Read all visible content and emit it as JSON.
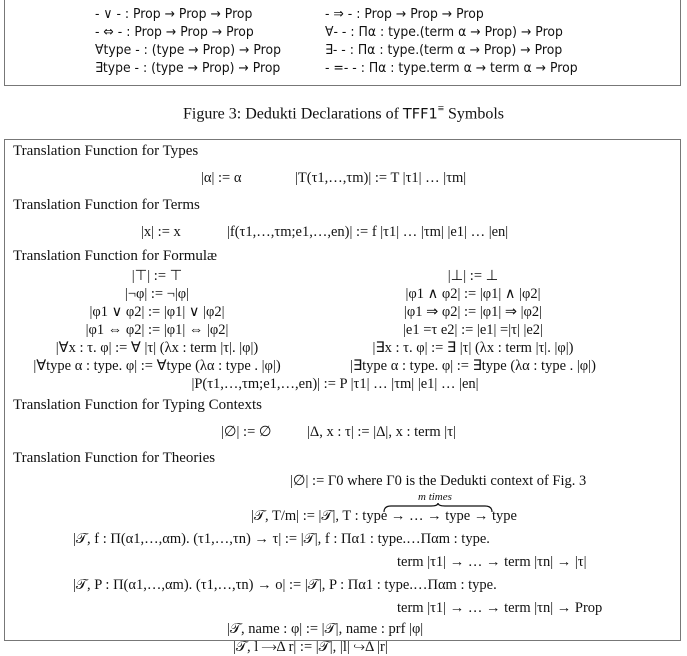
{
  "figure3": {
    "declarations_left": [
      "- ∨ - : Prop → Prop → Prop",
      "- ⇔ - : Prop → Prop → Prop",
      "∀type - : (type → Prop) → Prop",
      "∃type - : (type → Prop) → Prop"
    ],
    "declarations_right": [
      "- ⇒ - : Prop → Prop → Prop",
      "∀- - : Πα : type.(term α → Prop) → Prop",
      "∃- - : Πα : type.(term α → Prop) → Prop",
      "- =- - : Πα : type.term α → term α → Prop"
    ],
    "caption_prefix": "Figure 3: Dedukti Declarations of ",
    "caption_name": "TFF1",
    "caption_sup": "≡",
    "caption_suffix": " Symbols"
  },
  "translation": {
    "types_header": "Translation Function for Types",
    "types": [
      "|α| := α",
      "|T(τ1,…,τm)| := T |τ1| … |τm|"
    ],
    "terms_header": "Translation Function for Terms",
    "terms": [
      "|x| := x",
      "|f(τ1,…,τm;e1,…,en)| := f |τ1| … |τm| |e1| … |en|"
    ],
    "formulae_header": "Translation Function for Formulæ",
    "formulae_left": [
      "|⊤| := ⊤",
      "|¬φ| := ¬|φ|",
      "|φ1 ∨ φ2| := |φ1| ∨ |φ2|",
      "|φ1 ⇔ φ2| := |φ1| ⇔ |φ2|",
      "|∀x : τ. φ| := ∀ |τ| (λx : term |τ|. |φ|)",
      "|∀type α : type. φ| := ∀type (λα : type . |φ|)"
    ],
    "formulae_right": [
      "|⊥| := ⊥",
      "|φ1 ∧ φ2| := |φ1| ∧ |φ2|",
      "|φ1 ⇒ φ2| := |φ1| ⇒ |φ2|",
      "|e1 =τ e2| := |e1| =|τ| |e2|",
      "|∃x : τ. φ| := ∃ |τ| (λx : term |τ|. |φ|)",
      "|∃type α : type. φ| := ∃type (λα : type . |φ|)"
    ],
    "formulae_predicate": "|P(τ1,…,τm;e1,…,en)| := P |τ1| … |τm| |e1| … |en|",
    "contexts_header": "Translation Function for Typing Contexts",
    "contexts": [
      "|∅| := ∅",
      "|Δ, x : τ| := |Δ|, x : term |τ|"
    ],
    "theories_header": "Translation Function for Theories",
    "theories": {
      "empty": "|∅| := Γ0 where Γ0 is the Dedukti context of Fig. 3",
      "brace_label": "m times",
      "type_decl": "|𝒯, T/m| := |𝒯|, T : type → … → type → type",
      "fun_decl_1": "|𝒯, f : Π(α1,…,αm). (τ1,…,τn) → τ| := |𝒯|, f : Πα1 : type.…Παm : type.",
      "fun_decl_2": "term |τ1| → … → term |τn| → |τ|",
      "pred_decl_1": "|𝒯, P : Π(α1,…,αm). (τ1,…,τn) → o| := |𝒯|, P : Πα1 : type.…Παm : type.",
      "pred_decl_2": "term |τ1| → … → term |τn| → Prop",
      "axiom": "|𝒯, name : φ| := |𝒯|, name : prf |φ|",
      "rewrite": "|𝒯, l ⟶Δ r| := |𝒯|, |l| ↪Δ |r|"
    }
  }
}
